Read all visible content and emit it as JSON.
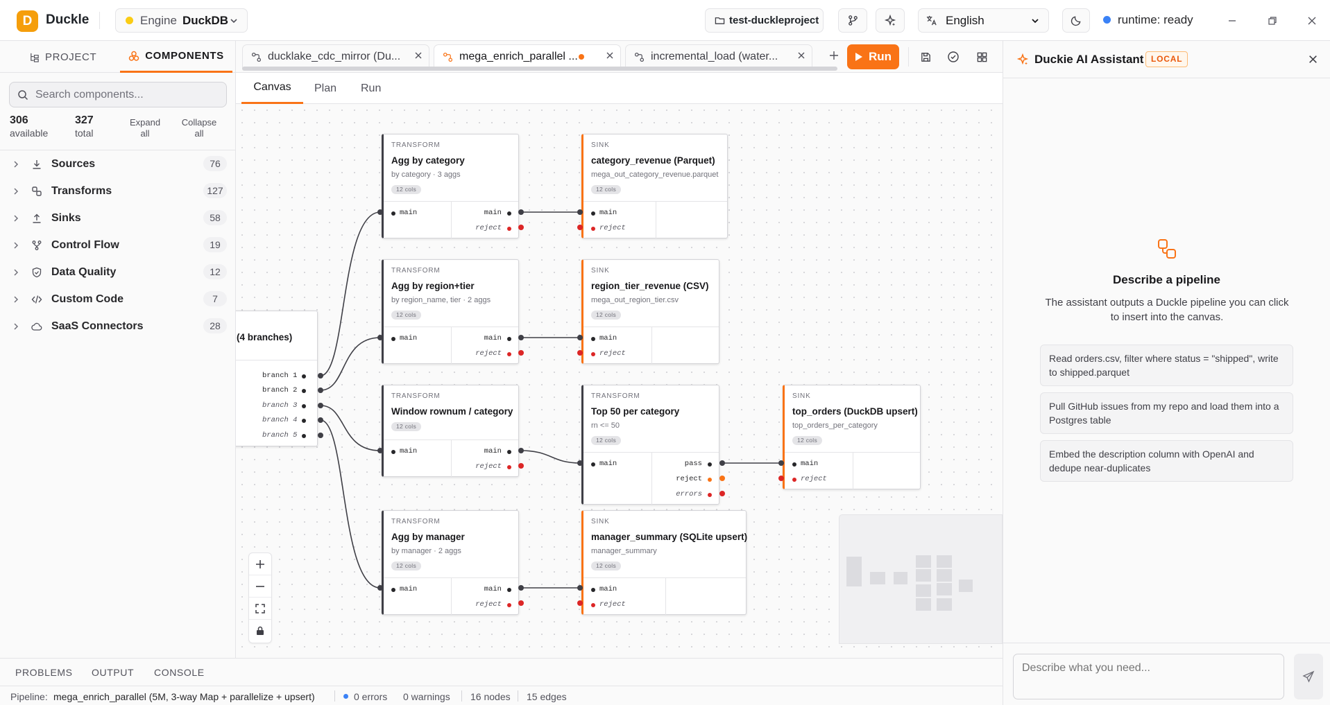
{
  "app": {
    "logo_letter": "D",
    "name": "Duckle"
  },
  "topbar": {
    "engine_label": "Engine",
    "engine_value": "DuckDB",
    "project": "test-duckleproject",
    "language": "English",
    "runtime": "runtime: ready"
  },
  "left": {
    "tabs": [
      {
        "label": "PROJECT"
      },
      {
        "label": "COMPONENTS"
      }
    ],
    "search_placeholder": "Search components...",
    "stats": {
      "available": "306",
      "available_label": "available",
      "total": "327",
      "total_label": "total"
    },
    "expand_all": "Expand all",
    "collapse_all": "Collapse all",
    "categories": [
      {
        "label": "Sources",
        "count": "76"
      },
      {
        "label": "Transforms",
        "count": "127"
      },
      {
        "label": "Sinks",
        "count": "58"
      },
      {
        "label": "Control Flow",
        "count": "19"
      },
      {
        "label": "Data Quality",
        "count": "12"
      },
      {
        "label": "Custom Code",
        "count": "7"
      },
      {
        "label": "SaaS Connectors",
        "count": "28"
      }
    ]
  },
  "file_tabs": [
    {
      "label": "ducklake_cdc_mirror (Du..."
    },
    {
      "label": "mega_enrich_parallel ..."
    },
    {
      "label": "incremental_load (water..."
    }
  ],
  "run_label": "Run",
  "subtabs": [
    {
      "label": "Canvas"
    },
    {
      "label": "Plan"
    },
    {
      "label": "Run"
    }
  ],
  "canvas": {
    "branch_node": {
      "title": "(4 branches)",
      "ports": [
        "branch 1",
        "branch 2",
        "branch 3",
        "branch 4",
        "branch 5"
      ]
    },
    "nodes": [
      {
        "kind": "TRANSFORM",
        "title": "Agg by category",
        "sub": "by category · 3 aggs",
        "cols": "12 cols",
        "in": "main",
        "out1": "main",
        "out2": "reject"
      },
      {
        "kind": "SINK",
        "title": "category_revenue (Parquet)",
        "sub": "mega_out_category_revenue.parquet",
        "cols": "12 cols",
        "in1": "main",
        "in2": "reject"
      },
      {
        "kind": "TRANSFORM",
        "title": "Agg by region+tier",
        "sub": "by region_name, tier · 2 aggs",
        "cols": "12 cols",
        "in": "main",
        "out1": "main",
        "out2": "reject"
      },
      {
        "kind": "SINK",
        "title": "region_tier_revenue (CSV)",
        "sub": "mega_out_region_tier.csv",
        "cols": "12 cols",
        "in1": "main",
        "in2": "reject"
      },
      {
        "kind": "TRANSFORM",
        "title": "Window rownum / category",
        "cols": "12 cols",
        "in": "main",
        "out1": "main",
        "out2": "reject"
      },
      {
        "kind": "TRANSFORM",
        "title": "Top 50 per category",
        "sub": "rn <= 50",
        "cols": "12 cols",
        "in": "main",
        "out1": "pass",
        "out2": "reject",
        "out3": "errors"
      },
      {
        "kind": "SINK",
        "title": "top_orders (DuckDB upsert)",
        "sub": "top_orders_per_category",
        "cols": "12 cols",
        "in1": "main",
        "in2": "reject"
      },
      {
        "kind": "TRANSFORM",
        "title": "Agg by manager",
        "sub": "by manager · 2 aggs",
        "cols": "12 cols",
        "in": "main",
        "out1": "main",
        "out2": "reject"
      },
      {
        "kind": "SINK",
        "title": "manager_summary (SQLite upsert)",
        "sub": "manager_summary",
        "cols": "12 cols",
        "in1": "main",
        "in2": "reject"
      }
    ]
  },
  "bottom_tabs": [
    {
      "label": "PROBLEMS"
    },
    {
      "label": "OUTPUT"
    },
    {
      "label": "CONSOLE"
    }
  ],
  "status": {
    "pipeline_label": "Pipeline:",
    "pipeline_value": "mega_enrich_parallel (5M, 3-way Map + parallelize + upsert)",
    "errors": "0 errors",
    "warnings": "0 warnings",
    "nodes": "16 nodes",
    "edges": "15 edges"
  },
  "assistant": {
    "title": "Duckie AI Assistant",
    "badge": "LOCAL",
    "empty_title": "Describe a pipeline",
    "empty_desc": "The assistant outputs a Duckle pipeline you can click to insert into the canvas.",
    "suggestions": [
      "Read orders.csv, filter where status = \"shipped\", write to shipped.parquet",
      "Pull GitHub issues from my repo and load them into a Postgres table",
      "Embed the description column with OpenAI and dedupe near-duplicates"
    ],
    "input_placeholder": "Describe what you need..."
  },
  "colors": {
    "accent": "#f97316",
    "engine_dot": "#facc15",
    "runtime_dot": "#3b82f6",
    "reject": "#dc2626"
  }
}
